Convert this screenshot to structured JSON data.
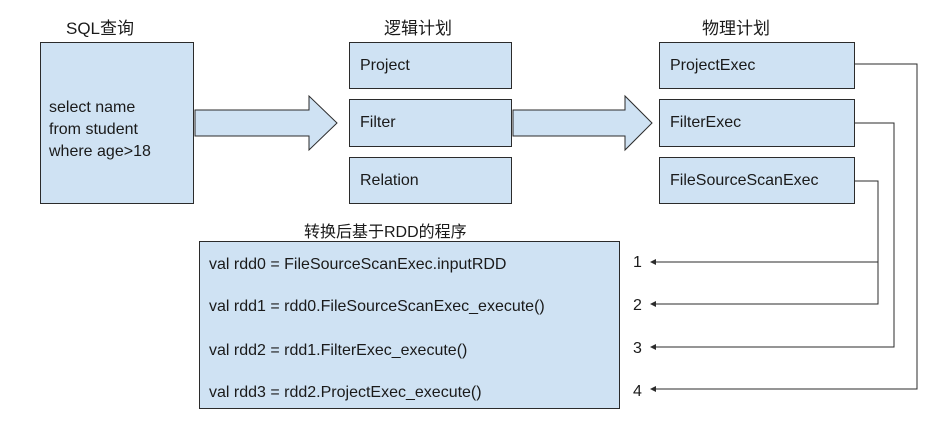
{
  "columns": {
    "sql": "SQL查询",
    "logical": "逻辑计划",
    "physical": "物理计划"
  },
  "sql_query": [
    "select name",
    "from student",
    "where age>18"
  ],
  "logical_plan": [
    "Project",
    "Filter",
    "Relation"
  ],
  "physical_plan": [
    "ProjectExec",
    "FilterExec",
    "FileSourceScanExec"
  ],
  "rdd_program": {
    "title": "转换后基于RDD的程序",
    "lines": [
      "val rdd0 = FileSourceScanExec.inputRDD",
      "val rdd1 = rdd0.FileSourceScanExec_execute()",
      "val rdd2 = rdd1.FilterExec_execute()",
      "val rdd3 = rdd2.ProjectExec_execute()"
    ],
    "numbers": [
      "1",
      "2",
      "3",
      "4"
    ]
  },
  "colors": {
    "box_fill": "#cfe2f3",
    "border": "#2b2b2b"
  }
}
